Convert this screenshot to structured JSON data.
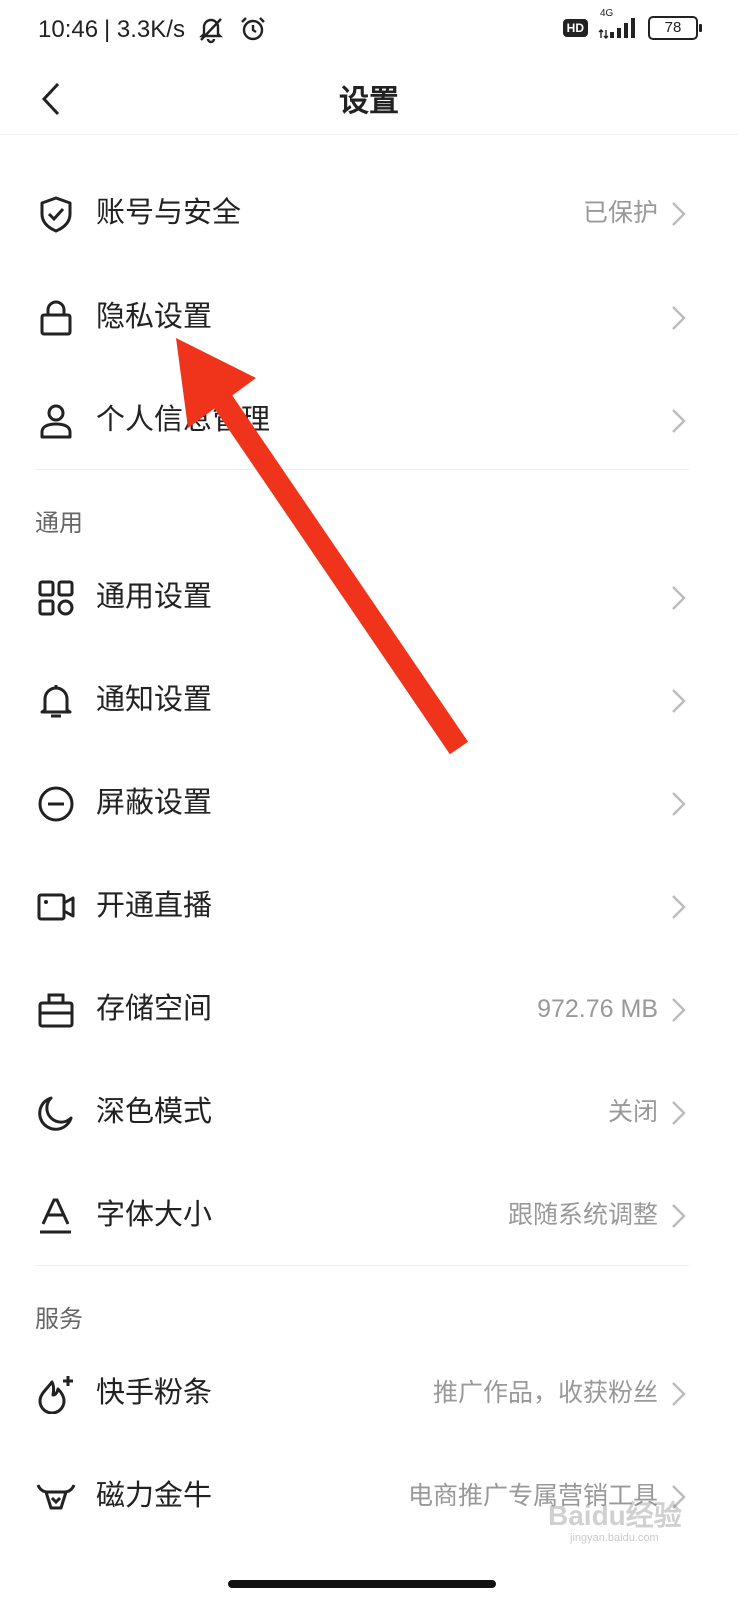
{
  "status_bar": {
    "time": "10:46",
    "speed": "| 3.3K/s",
    "hd": "HD",
    "network": "4G",
    "battery": "78"
  },
  "header": {
    "title": "设置"
  },
  "account_section": {
    "items": [
      {
        "label": "账号与安全",
        "value": "已保护",
        "icon": "shield-icon"
      },
      {
        "label": "隐私设置",
        "value": "",
        "icon": "lock-icon"
      },
      {
        "label": "个人信息管理",
        "value": "",
        "icon": "person-icon"
      }
    ]
  },
  "general_section": {
    "title": "通用",
    "items": [
      {
        "label": "通用设置",
        "value": "",
        "icon": "grid-icon"
      },
      {
        "label": "通知设置",
        "value": "",
        "icon": "bell-icon"
      },
      {
        "label": "屏蔽设置",
        "value": "",
        "icon": "block-icon"
      },
      {
        "label": "开通直播",
        "value": "",
        "icon": "video-camera-icon"
      },
      {
        "label": "存储空间",
        "value": "972.76 MB",
        "icon": "storage-box-icon"
      },
      {
        "label": "深色模式",
        "value": "关闭",
        "icon": "moon-icon"
      },
      {
        "label": "字体大小",
        "value": "跟随系统调整",
        "icon": "font-size-icon"
      }
    ]
  },
  "service_section": {
    "title": "服务",
    "items": [
      {
        "label": "快手粉条",
        "value": "推广作品，收获粉丝",
        "icon": "flame-plus-icon"
      },
      {
        "label": "磁力金牛",
        "value": "电商推广专属营销工具",
        "icon": "bull-icon"
      }
    ]
  },
  "annotation": {
    "arrow_color": "#f0341c"
  },
  "watermark": {
    "text": "Baidu经验",
    "sub": "jingyan.baidu.com"
  }
}
